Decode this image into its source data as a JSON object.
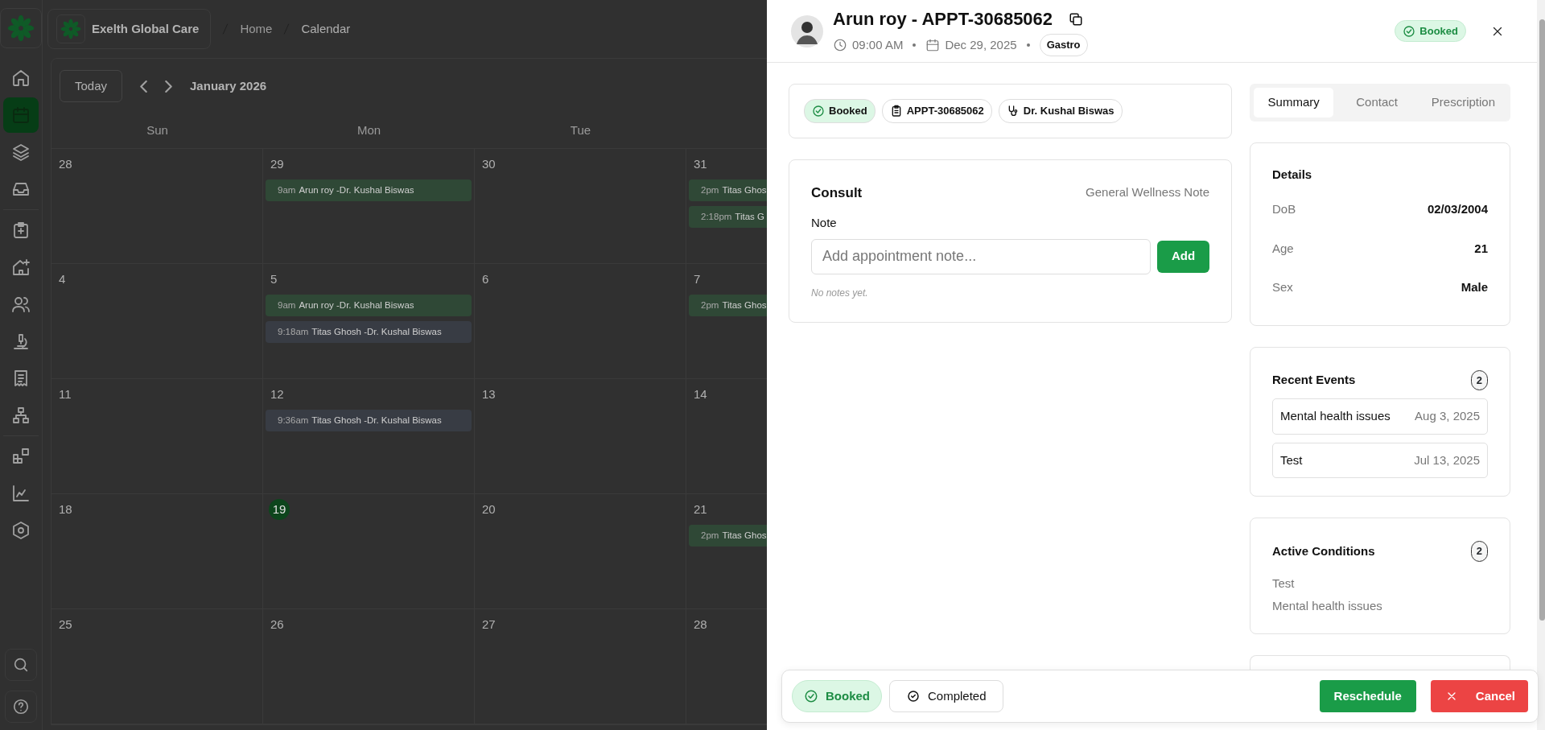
{
  "sidebar": {
    "items": [
      {
        "selected": false
      },
      {
        "selected": true
      },
      {
        "selected": false
      },
      {
        "selected": false
      },
      {
        "selected": false
      },
      {
        "selected": false
      },
      {
        "selected": false
      },
      {
        "selected": false
      },
      {
        "selected": false
      },
      {
        "selected": false
      },
      {
        "selected": false
      },
      {
        "selected": false
      },
      {
        "selected": false
      }
    ]
  },
  "brand": {
    "name": "Exelth Global Care"
  },
  "breadcrumb": [
    "Home",
    "Calendar"
  ],
  "calendar": {
    "today_button": "Today",
    "month": "January 2026",
    "weekdays": [
      "Sun",
      "Mon",
      "Tue"
    ],
    "weeks": [
      [
        {
          "day": "28",
          "today": false
        },
        {
          "day": "29",
          "today": false,
          "events": [
            {
              "time": "9am",
              "title": "Arun roy -Dr. Kushal Biswas",
              "color": "#2f4836"
            }
          ]
        },
        {
          "day": "30",
          "today": false
        },
        {
          "day": "31",
          "today": false,
          "events": [
            {
              "time": "2pm",
              "title": "Titas Ghos",
              "color": "#2f4836"
            },
            {
              "time": "2:18pm",
              "title": "Titas G",
              "color": "#2f4836"
            }
          ]
        }
      ],
      [
        {
          "day": "4",
          "today": false
        },
        {
          "day": "5",
          "today": false,
          "events": [
            {
              "time": "9am",
              "title": "Arun roy -Dr. Kushal Biswas",
              "color": "#2f4836"
            },
            {
              "time": "9:18am",
              "title": "Titas Ghosh -Dr. Kushal Biswas",
              "color": "#383c44"
            }
          ]
        },
        {
          "day": "6",
          "today": false
        },
        {
          "day": "7",
          "today": false,
          "events": [
            {
              "time": "2pm",
              "title": "Titas Ghos",
              "color": "#2f4836"
            }
          ]
        }
      ],
      [
        {
          "day": "11",
          "today": false
        },
        {
          "day": "12",
          "today": false,
          "events": [
            {
              "time": "9:36am",
              "title": "Titas Ghosh -Dr. Kushal Biswas",
              "color": "#383c44"
            }
          ]
        },
        {
          "day": "13",
          "today": false
        },
        {
          "day": "14",
          "today": false
        }
      ],
      [
        {
          "day": "18",
          "today": false
        },
        {
          "day": "19",
          "today": true
        },
        {
          "day": "20",
          "today": false
        },
        {
          "day": "21",
          "today": false,
          "events": [
            {
              "time": "2pm",
              "title": "Titas Ghos",
              "color": "#2f4836"
            }
          ]
        }
      ],
      [
        {
          "day": "25",
          "today": false
        },
        {
          "day": "26",
          "today": false
        },
        {
          "day": "27",
          "today": false
        },
        {
          "day": "28",
          "today": false
        }
      ]
    ]
  },
  "drawer": {
    "title": "Arun roy - APPT-30685062",
    "time": "09:00 AM",
    "date": "Dec 29, 2025",
    "tag": "Gastro",
    "status": "Booked",
    "chips": [
      {
        "kind": "status",
        "label": "Booked"
      },
      {
        "kind": "id",
        "label": "APPT-30685062"
      },
      {
        "kind": "doctor",
        "label": "Dr. Kushal Biswas"
      }
    ],
    "consult": {
      "title": "Consult",
      "subtitle": "General Wellness Note",
      "note_label": "Note",
      "placeholder": "Add appointment note...",
      "button": "Add",
      "empty": "No notes yet."
    },
    "tabs": [
      {
        "label": "Summary",
        "selected": true
      },
      {
        "label": "Contact",
        "selected": false
      },
      {
        "label": "Prescription",
        "selected": false
      }
    ],
    "details": {
      "title": "Details",
      "rows": [
        {
          "label": "DoB",
          "value": "02/03/2004"
        },
        {
          "label": "Age",
          "value": "21"
        },
        {
          "label": "Sex",
          "value": "Male"
        }
      ]
    },
    "recent_events": {
      "title": "Recent Events",
      "count": "2",
      "items": [
        {
          "name": "Mental health issues",
          "date": "Aug 3, 2025"
        },
        {
          "name": "Test",
          "date": "Jul 13, 2025"
        }
      ]
    },
    "conditions": {
      "title": "Active Conditions",
      "count": "2",
      "items": [
        "Test",
        "Mental health issues"
      ]
    },
    "footer": {
      "statuses": [
        {
          "label": "Booked",
          "selected": true
        },
        {
          "label": "Completed",
          "selected": false
        }
      ],
      "reschedule": "Reschedule",
      "cancel": "Cancel"
    }
  }
}
